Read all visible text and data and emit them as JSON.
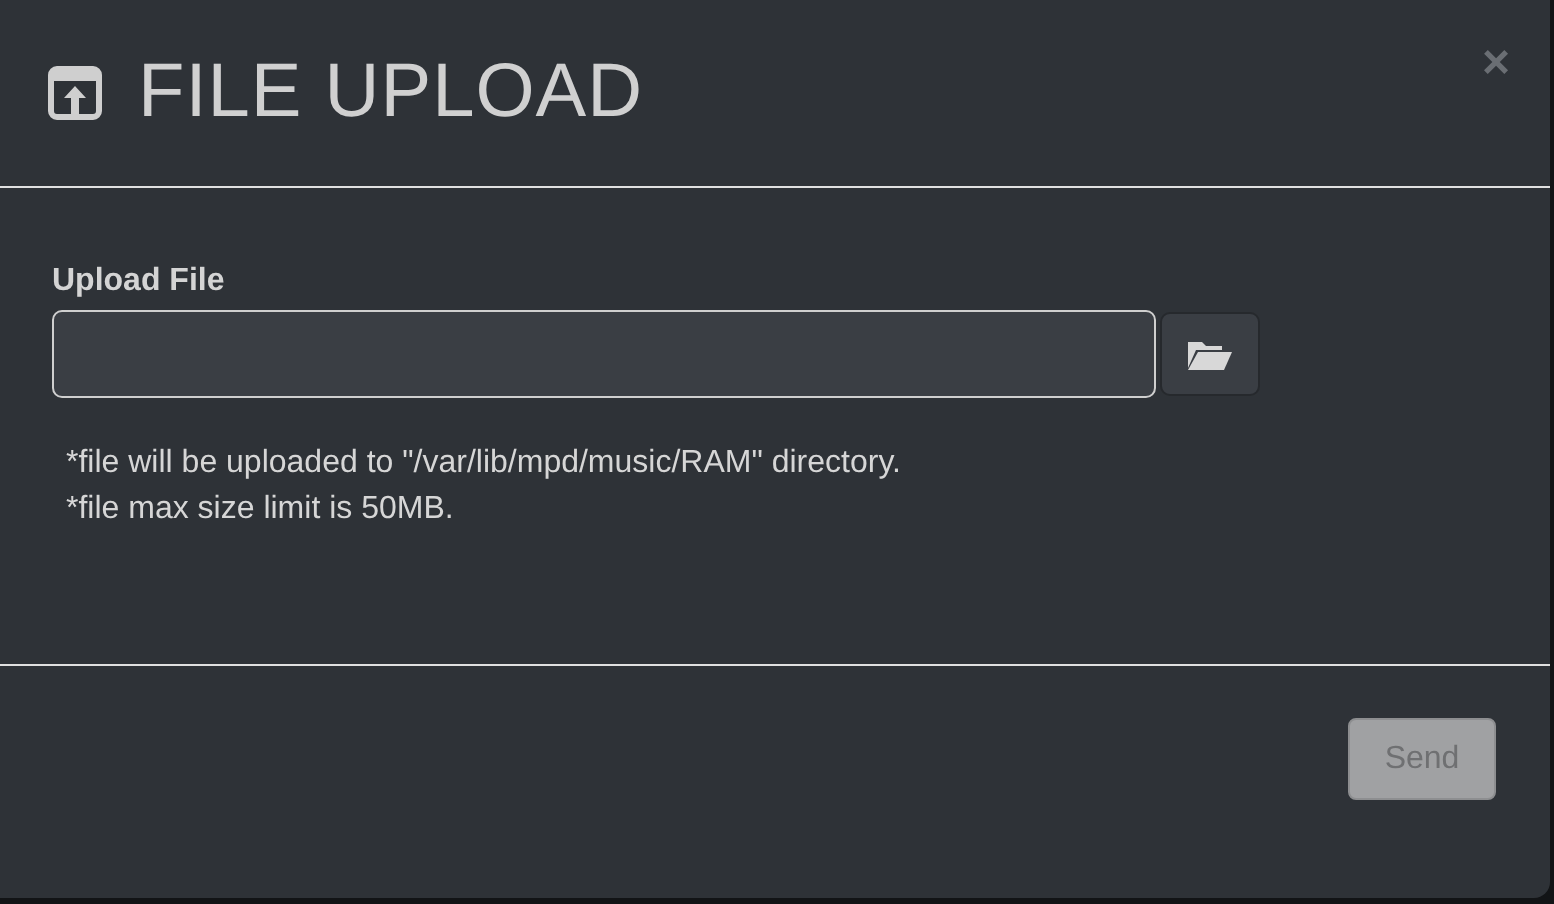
{
  "dialog": {
    "title": "FILE UPLOAD",
    "close": "×"
  },
  "field": {
    "label": "Upload File"
  },
  "notes": [
    "*file will be uploaded to \"/var/lib/mpd/music/RAM\" directory.",
    "*file max size limit is 50MB."
  ],
  "buttons": [
    {
      "label": "Send",
      "disabled": true
    }
  ]
}
